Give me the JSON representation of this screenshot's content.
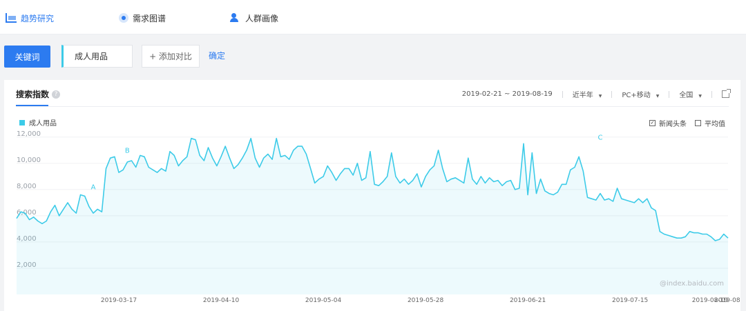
{
  "nav": {
    "trend": "趋势研究",
    "demand": "需求图谱",
    "crowd": "人群画像"
  },
  "search": {
    "keyword_button": "关键词",
    "keyword_value": "成人用品",
    "add_compare": "+ 添加对比",
    "confirm": "确定"
  },
  "panel": {
    "title": "搜索指数",
    "help": "?",
    "date_range": "2019-02-21 ~ 2019-08-19",
    "period": "近半年",
    "device": "PC+移动",
    "region": "全国",
    "legend": "成人用品",
    "option_news": "新闻头条",
    "option_avg": "平均值",
    "watermark": "@index.baidu.com",
    "colors": {
      "accent": "#2c7bf0",
      "series": "#3ccbe8"
    }
  },
  "chart_data": {
    "type": "area",
    "y_ticks": [
      "12,000",
      "10,000",
      "8,000",
      "6,000",
      "4,000",
      "2,000"
    ],
    "ylim": [
      0,
      12200
    ],
    "x_tick_labels": [
      "2019-03-17",
      "2019-04-10",
      "2019-05-04",
      "2019-05-28",
      "2019-06-21",
      "2019-07-15",
      "2019-08-08",
      "2019-08-19"
    ],
    "annotations": [
      {
        "label": "A",
        "x": "2019-03-11",
        "value": 7700
      },
      {
        "label": "B",
        "x": "2019-03-19",
        "value": 10500
      },
      {
        "label": "C",
        "x": "2019-07-08",
        "value": 11500
      }
    ],
    "series": [
      {
        "name": "成人用品",
        "start": "2019-02-21",
        "values": [
          5800,
          6300,
          6200,
          5700,
          5900,
          5600,
          5400,
          5600,
          6300,
          6800,
          6000,
          6500,
          7000,
          6500,
          6200,
          7600,
          7500,
          6700,
          6200,
          6500,
          6300,
          9600,
          10400,
          10500,
          9300,
          9500,
          10100,
          10200,
          9700,
          10600,
          10500,
          9700,
          9500,
          9300,
          9600,
          9400,
          10900,
          10600,
          9800,
          10200,
          10500,
          11900,
          11800,
          10600,
          10200,
          11200,
          10400,
          9800,
          10500,
          11300,
          10400,
          9600,
          9900,
          10400,
          11000,
          11900,
          10400,
          9700,
          10400,
          10700,
          10300,
          11900,
          10500,
          10600,
          10300,
          11000,
          11300,
          11300,
          10700,
          9600,
          8500,
          8800,
          9000,
          9800,
          9300,
          8700,
          9200,
          9600,
          9600,
          9100,
          10000,
          8700,
          8900,
          10900,
          8400,
          8300,
          8600,
          9000,
          10800,
          9000,
          8500,
          8800,
          8400,
          8700,
          9200,
          8200,
          9000,
          9500,
          9800,
          11000,
          9600,
          8600,
          8800,
          8900,
          8700,
          8500,
          10400,
          8800,
          8400,
          9000,
          8500,
          8900,
          8600,
          8700,
          8300,
          8600,
          8700,
          8000,
          8100,
          11500,
          7600,
          10800,
          7700,
          8800,
          7900,
          7700,
          7600,
          7800,
          8400,
          8400,
          9500,
          9700,
          10500,
          9400,
          7400,
          7300,
          7200,
          7700,
          7200,
          7300,
          7100,
          8100,
          7300,
          7200,
          7100,
          7000,
          7300,
          7000,
          7300,
          6600,
          6400,
          4800,
          4600,
          4500,
          4400,
          4300,
          4300,
          4400,
          4800,
          4700,
          4700,
          4600,
          4600,
          4400,
          4100,
          4200,
          4600,
          4300
        ]
      }
    ]
  }
}
